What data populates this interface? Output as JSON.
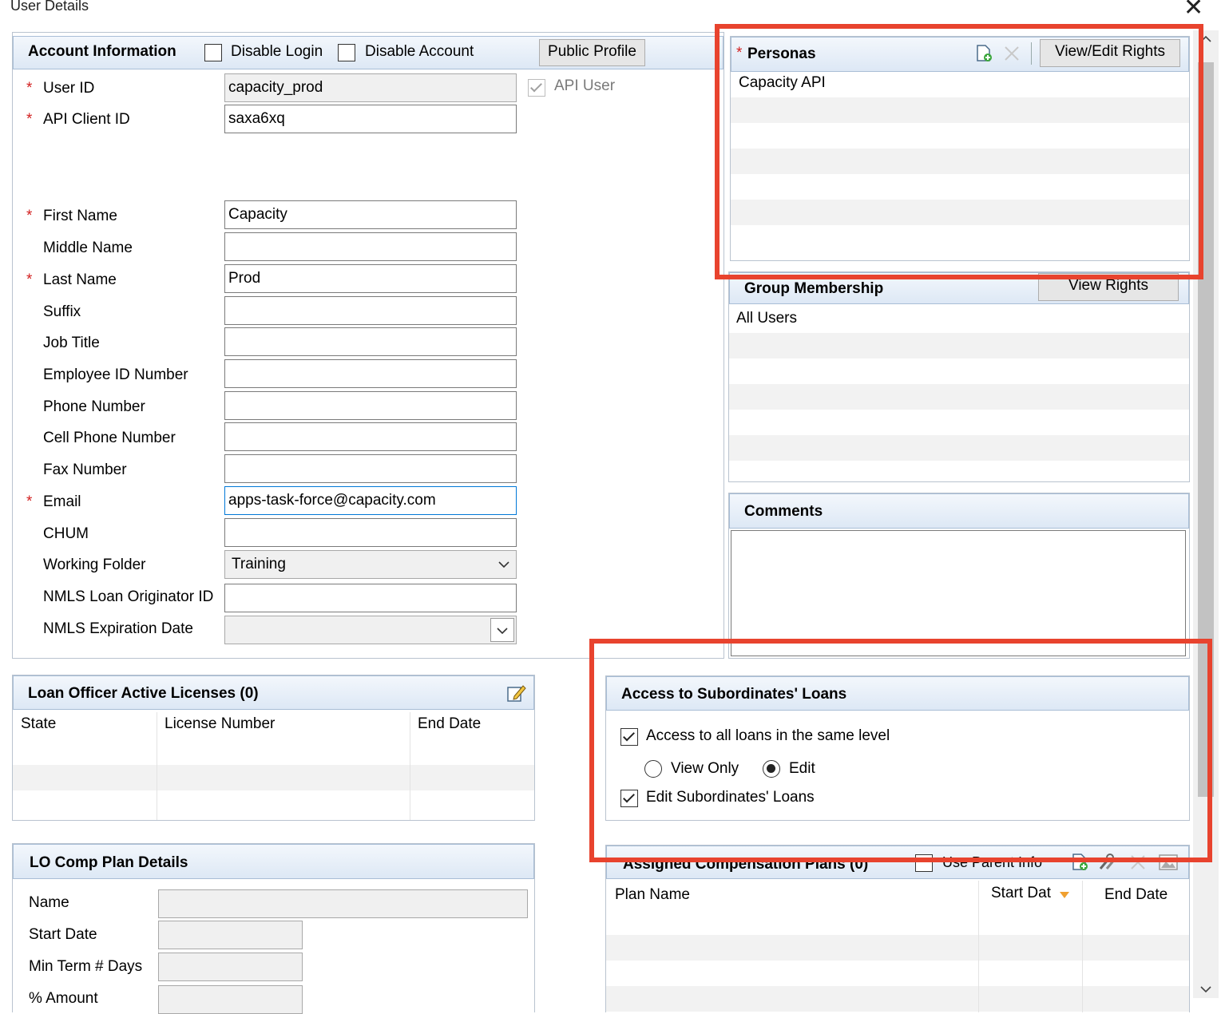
{
  "window": {
    "title": "User Details",
    "close_glyph": "✕"
  },
  "account": {
    "header": "Account Information",
    "disable_login": "Disable Login",
    "disable_account": "Disable Account",
    "public_profile": "Public Profile",
    "api_user": "API User",
    "fields": {
      "user_id": {
        "label": "User ID",
        "value": "capacity_prod"
      },
      "api_client_id": {
        "label": "API Client ID",
        "value": "saxa6xq"
      },
      "first_name": {
        "label": "First Name",
        "value": "Capacity"
      },
      "middle_name": {
        "label": "Middle Name",
        "value": ""
      },
      "last_name": {
        "label": "Last Name",
        "value": "Prod"
      },
      "suffix": {
        "label": "Suffix",
        "value": ""
      },
      "job_title": {
        "label": "Job Title",
        "value": ""
      },
      "employee_id": {
        "label": "Employee ID Number",
        "value": ""
      },
      "phone": {
        "label": "Phone Number",
        "value": ""
      },
      "cell": {
        "label": "Cell Phone Number",
        "value": ""
      },
      "fax": {
        "label": "Fax Number",
        "value": ""
      },
      "email": {
        "label": "Email",
        "value": "apps-task-force@capacity.com"
      },
      "chum": {
        "label": "CHUM",
        "value": ""
      },
      "working_folder": {
        "label": "Working Folder",
        "value": "Training"
      },
      "nmls_id": {
        "label": "NMLS Loan Originator ID",
        "value": ""
      },
      "nmls_exp": {
        "label": "NMLS Expiration Date",
        "value": ""
      }
    }
  },
  "personas": {
    "header": "Personas",
    "view_edit_rights": "View/Edit Rights",
    "items": [
      "Capacity API"
    ]
  },
  "groups": {
    "header": "Group Membership",
    "view_rights": "View Rights",
    "items": [
      "All Users"
    ]
  },
  "comments": {
    "header": "Comments",
    "value": ""
  },
  "licenses": {
    "header": "Loan Officer Active Licenses (0)",
    "columns": [
      "State",
      "License Number",
      "End Date"
    ]
  },
  "subordinates": {
    "header": "Access to Subordinates' Loans",
    "access_all": "Access to all loans in the same level",
    "view_only": "View Only",
    "edit": "Edit",
    "edit_subordinates": "Edit Subordinates' Loans"
  },
  "comp_plan": {
    "header": "LO Comp Plan Details",
    "name": "Name",
    "start_date": "Start Date",
    "min_term": "Min Term # Days",
    "amount": "% Amount"
  },
  "assigned": {
    "header": "Assigned Compensation Plans (0)",
    "use_parent": "Use Parent Info",
    "columns": [
      "Plan Name",
      "Start Dat",
      "End Date"
    ]
  },
  "colors": {
    "highlight": "#e8432e",
    "required": "#d21f1f",
    "header_bg": "#dde8f5"
  }
}
